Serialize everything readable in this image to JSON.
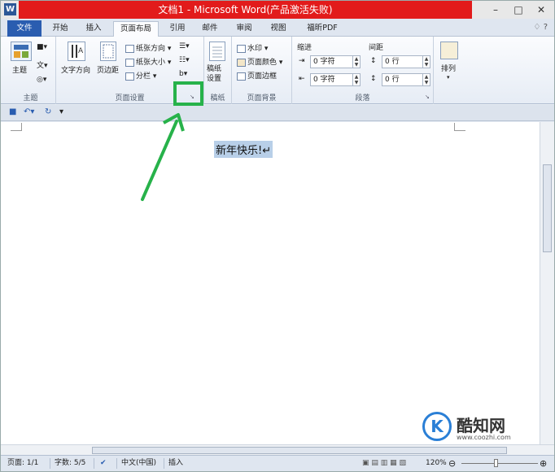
{
  "window": {
    "title": "文档1 - Microsoft Word(产品激活失败)",
    "app_icon": "W",
    "controls": [
      "–",
      "□",
      "✕"
    ]
  },
  "tabs": [
    "文件",
    "开始",
    "插入",
    "页面布局",
    "引用",
    "邮件",
    "审阅",
    "视图",
    "福昕PDF"
  ],
  "tab_right_icons": "♢ ?",
  "ribbon": {
    "theme": {
      "label": "主题",
      "big": "主题"
    },
    "page_setup": {
      "label": "页面设置",
      "text_direction": "文字方向",
      "margins": "页边距",
      "orientation": "纸张方向",
      "size": "纸张大小",
      "columns": "分栏"
    },
    "draft": {
      "label": "稿纸",
      "button": "稿纸\n设置"
    },
    "background": {
      "label": "页面背景",
      "watermark": "水印",
      "page_color": "页面颜色",
      "page_border": "页面边框"
    },
    "paragraph": {
      "label": "段落",
      "indent": "缩进",
      "spacing": "间距",
      "indent_left": "0 字符",
      "indent_right": "0 字符",
      "space_before": "0 行",
      "space_after": "0 行"
    },
    "arrange": {
      "label": "排列"
    }
  },
  "document": {
    "text": "新年快乐!↵"
  },
  "status": {
    "page": "页面: 1/1",
    "words": "字数: 5/5",
    "language": "中文(中国)",
    "mode": "插入",
    "zoom": "120%"
  },
  "watermark": {
    "name": "酷知网",
    "url": "www.coozhi.com",
    "logo": "K"
  },
  "colors": {
    "title_red": "#e21b1b",
    "file_tab": "#2a5db0",
    "highlight": "#27b24a"
  }
}
